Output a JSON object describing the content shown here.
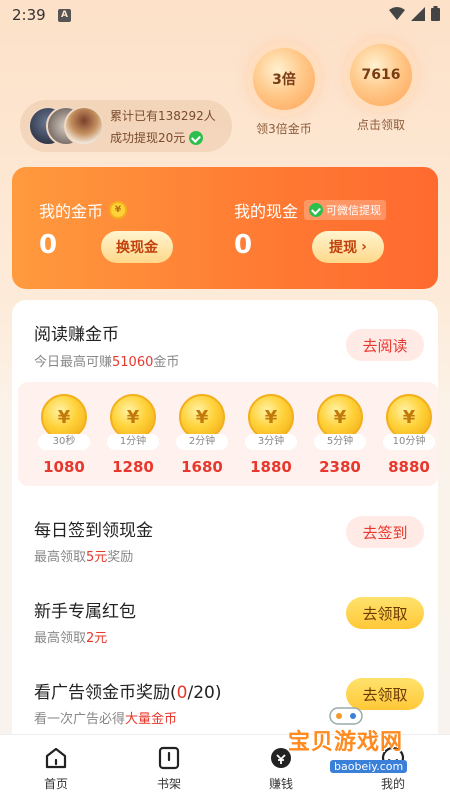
{
  "status_bar": {
    "time": "2:39",
    "badge": "A"
  },
  "header": {
    "stats_line": "累计已有138292人",
    "withdraw_line": "成功提现20元",
    "bubbles": [
      {
        "value": "3倍",
        "caption": "领3倍金币"
      },
      {
        "value": "7616",
        "caption": "点击领取"
      }
    ]
  },
  "money": {
    "coins_title": "我的金币",
    "coins_value": "0",
    "coins_button": "换现金",
    "cash_title": "我的现金",
    "cash_tag": "可微信提现",
    "cash_value": "0",
    "cash_button": "提现",
    "cash_button_arrow": "›"
  },
  "tasks": {
    "read": {
      "title": "阅读赚金币",
      "sub_prefix": "今日最高可赚",
      "sub_highlight": "51060",
      "sub_suffix": "金币",
      "button": "去阅读",
      "items": [
        {
          "time": "30秒",
          "reward": "1080"
        },
        {
          "time": "1分钟",
          "reward": "1280"
        },
        {
          "time": "2分钟",
          "reward": "1680"
        },
        {
          "time": "3分钟",
          "reward": "1880"
        },
        {
          "time": "5分钟",
          "reward": "2380"
        },
        {
          "time": "10分钟",
          "reward": "8880"
        }
      ]
    },
    "checkin": {
      "title": "每日签到领现金",
      "sub_prefix": "最高领取",
      "sub_highlight": "5元",
      "sub_suffix": "奖励",
      "button": "去签到"
    },
    "newbie": {
      "title": "新手专属红包",
      "sub_prefix": "最高领取",
      "sub_highlight": "2元",
      "button": "去领取"
    },
    "ads": {
      "title_prefix": "看广告领金币奖励(",
      "title_count": "0",
      "title_suffix": "/20)",
      "sub_prefix": "看一次广告必得",
      "sub_highlight": "大量金币",
      "button": "去领取"
    }
  },
  "nav": {
    "items": [
      {
        "label": "首页",
        "icon": "home-icon"
      },
      {
        "label": "书架",
        "icon": "book-icon"
      },
      {
        "label": "赚钱",
        "icon": "coin-icon"
      },
      {
        "label": "我的",
        "icon": "user-icon"
      }
    ]
  },
  "watermark": {
    "text": "宝贝游戏网",
    "url": "baobeiy.com"
  },
  "colors": {
    "accent": "#ff7a33",
    "highlight": "#e8382d",
    "gold": "#ffc837"
  }
}
